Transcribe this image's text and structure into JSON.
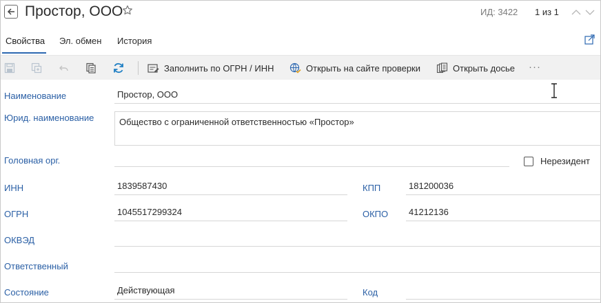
{
  "header": {
    "title": "Простор, ООО",
    "id_label": "ИД: 3422",
    "pager": "1 из 1",
    "icons": {
      "back": "arrow-left-icon",
      "favorite": "star-outline-icon",
      "prev": "chevron-up-icon",
      "next": "chevron-down-icon"
    }
  },
  "tabs": [
    {
      "label": "Свойства",
      "active": true
    },
    {
      "label": "Эл. обмен",
      "active": false
    },
    {
      "label": "История",
      "active": false
    }
  ],
  "toolbar": {
    "icons": [
      "save-icon",
      "save-copy-icon",
      "undo-icon",
      "copy-icon",
      "refresh-icon"
    ],
    "fill_button": "Заполнить по ОГРН / ИНН",
    "check_button": "Открыть на сайте проверки",
    "dossier_button": "Открыть досье",
    "more": "···"
  },
  "form": {
    "name": {
      "label": "Наименование",
      "value": "Простор, ООО"
    },
    "legal_name": {
      "label": "Юрид. наименование",
      "value": "Общество с ограниченной ответственностью «Простор»"
    },
    "head_org": {
      "label": "Головная орг.",
      "value": ""
    },
    "nonresident": {
      "label": "Нерезидент",
      "checked": false
    },
    "inn": {
      "label": "ИНН",
      "value": "1839587430"
    },
    "kpp": {
      "label": "КПП",
      "value": "181200036"
    },
    "ogrn": {
      "label": "ОГРН",
      "value": "1045517299324"
    },
    "okpo": {
      "label": "ОКПО",
      "value": "41212136"
    },
    "okved": {
      "label": "ОКВЭД",
      "value": ""
    },
    "responsible": {
      "label": "Ответственный",
      "value": ""
    },
    "state": {
      "label": "Состояние",
      "value": "Действующая"
    },
    "code": {
      "label": "Код",
      "value": ""
    }
  },
  "colors": {
    "accent": "#2a66b0",
    "label": "#2a5fa5",
    "toolbar_bg": "#f1f1f1",
    "refresh": "#1f7fc4"
  }
}
